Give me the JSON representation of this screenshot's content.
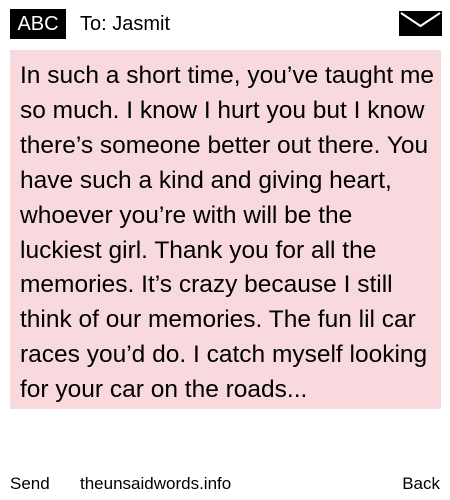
{
  "header": {
    "badge_label": "ABC",
    "recipient": "To: Jasmit",
    "envelope_icon": "envelope-icon"
  },
  "message": {
    "text": "In such a short time, you’ve taught me so much. I know I hurt you but I know there’s someone better out there. You have such a kind and giving heart, whoever you’re with will be the luckiest girl. Thank you for all the memories. It’s crazy because I still think of our memories. The fun lil car races you’d do. I catch myself looking for your car on the roads...",
    "highlight_color": "#f8d9dd"
  },
  "footer": {
    "send_label": "Send",
    "site_label": "theunsaidwords.info",
    "back_label": "Back"
  }
}
